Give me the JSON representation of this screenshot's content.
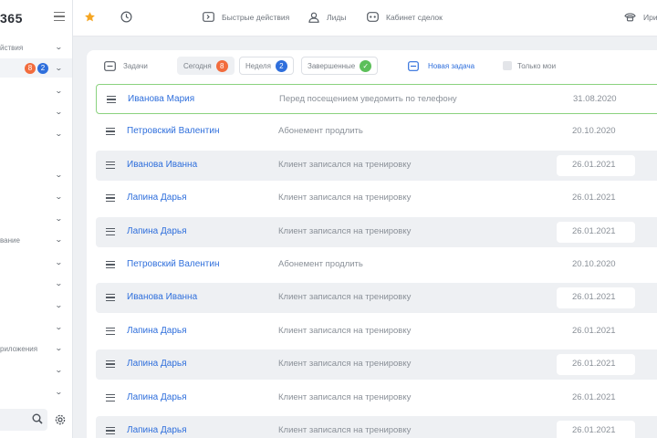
{
  "app": {
    "logo": "365"
  },
  "sidebar": {
    "labels": [
      "йствия",
      "вание",
      "риложения"
    ],
    "badges": [
      {
        "value": "8",
        "color": "#f26c3d"
      },
      {
        "value": "2",
        "color": "#2f6fdc"
      }
    ]
  },
  "topbar": {
    "quick_actions": "Быстрые действия",
    "leads": "Лиды",
    "deals": "Кабинет сделок",
    "user": "Ири"
  },
  "tabs": {
    "tasks": "Задачи",
    "today": "Сегодня",
    "today_count": "8",
    "week": "Неделя",
    "week_count": "2",
    "completed": "Завершенные",
    "new_task": "Новая задача",
    "only_mine": "Только мои"
  },
  "colors": {
    "accent": "#2f6fdc",
    "orange": "#f26c3d",
    "green": "#5cbf5a"
  },
  "rows": [
    {
      "name": "Иванова Мария",
      "desc": "Перед посещением уведомить по телефону",
      "date": "31.08.2020",
      "style": "highlight"
    },
    {
      "name": "Петровский Валентин",
      "desc": "Абонемент продлить",
      "date": "20.10.2020",
      "style": "plain"
    },
    {
      "name": "Иванова Иванна",
      "desc": "Клиент записался на тренировку",
      "date": "26.01.2021",
      "style": "grey"
    },
    {
      "name": "Лапина Дарья",
      "desc": "Клиент записался на тренировку",
      "date": "26.01.2021",
      "style": "plain"
    },
    {
      "name": "Лапина Дарья",
      "desc": "Клиент записался на тренировку",
      "date": "26.01.2021",
      "style": "grey"
    },
    {
      "name": "Петровский Валентин",
      "desc": "Абонемент продлить",
      "date": "20.10.2020",
      "style": "plain"
    },
    {
      "name": "Иванова Иванна",
      "desc": "Клиент записался на тренировку",
      "date": "26.01.2021",
      "style": "grey"
    },
    {
      "name": "Лапина Дарья",
      "desc": "Клиент записался на тренировку",
      "date": "26.01.2021",
      "style": "plain"
    },
    {
      "name": "Лапина Дарья",
      "desc": "Клиент записался на тренировку",
      "date": "26.01.2021",
      "style": "grey"
    },
    {
      "name": "Лапина Дарья",
      "desc": "Клиент записался на тренировку",
      "date": "26.01.2021",
      "style": "plain"
    },
    {
      "name": "Лапина Дарья",
      "desc": "Клиент записался на тренировку",
      "date": "26.01.2021",
      "style": "grey"
    }
  ]
}
